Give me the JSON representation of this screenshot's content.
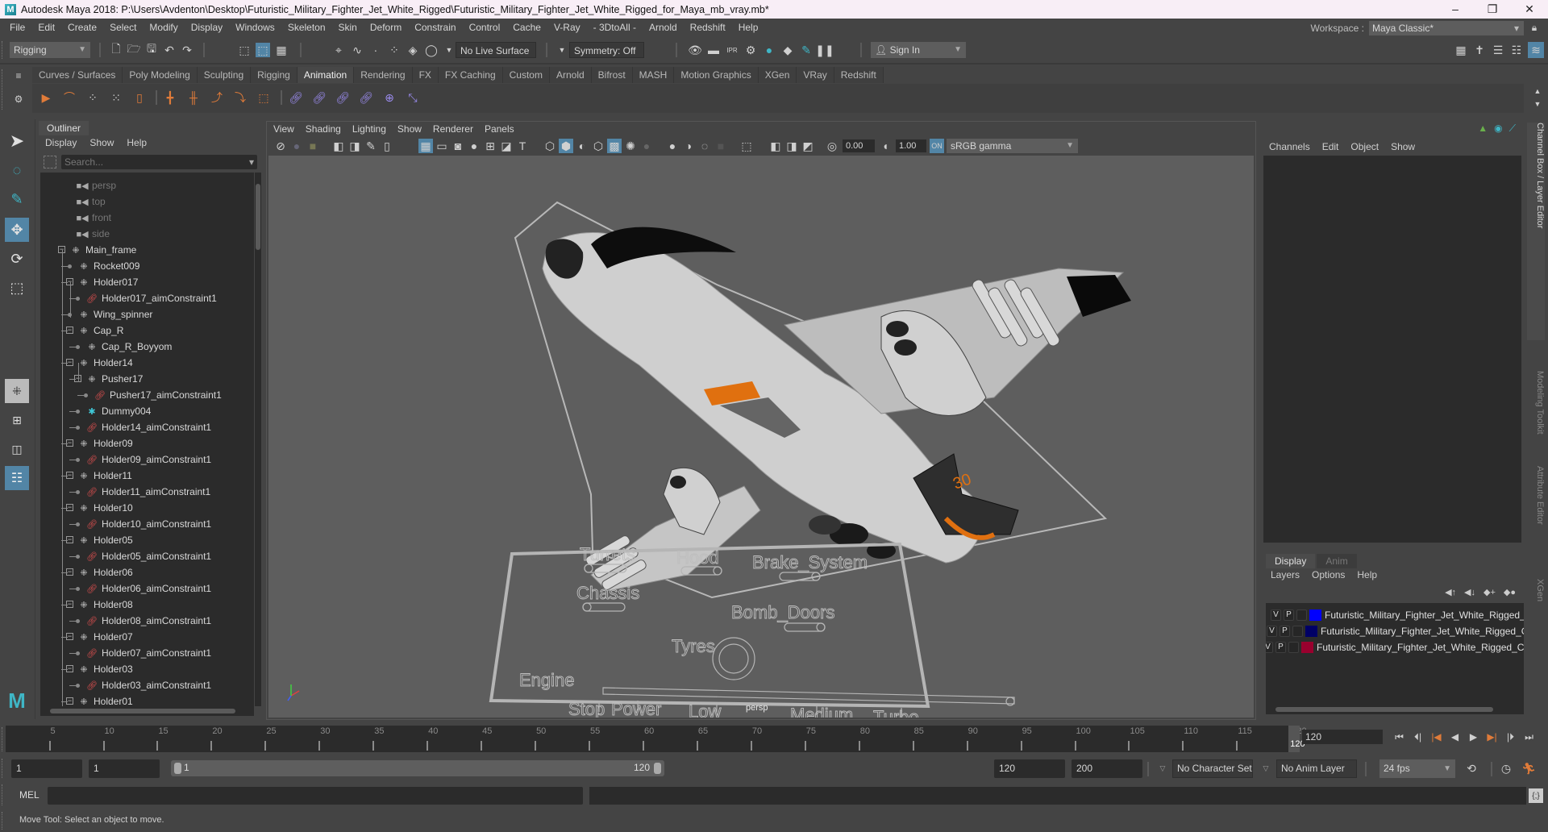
{
  "titlebar": {
    "title": "Autodesk Maya 2018: P:\\Users\\Avdenton\\Desktop\\Futuristic_Military_Fighter_Jet_White_Rigged\\Futuristic_Military_Fighter_Jet_White_Rigged_for_Maya_mb_vray.mb*",
    "minimize": "–",
    "maximize": "❐",
    "close": "✕"
  },
  "menubar": {
    "items": [
      "File",
      "Edit",
      "Create",
      "Select",
      "Modify",
      "Display",
      "Windows",
      "Skeleton",
      "Skin",
      "Deform",
      "Constrain",
      "Control",
      "Cache",
      "V-Ray",
      "- 3DtoAll -",
      "Arnold",
      "Redshift",
      "Help"
    ],
    "workspace_label": "Workspace :",
    "workspace_value": "Maya Classic*"
  },
  "statusline": {
    "menuset": "Rigging",
    "live_surface": "No Live Surface",
    "symmetry": "Symmetry: Off",
    "sign_in": "Sign In"
  },
  "shelf": {
    "tabs": [
      "Curves / Surfaces",
      "Poly Modeling",
      "Sculpting",
      "Rigging",
      "Animation",
      "Rendering",
      "FX",
      "FX Caching",
      "Custom",
      "Arnold",
      "Bifrost",
      "MASH",
      "Motion Graphics",
      "XGen",
      "VRay",
      "Redshift"
    ],
    "active_tab": "Animation"
  },
  "outliner": {
    "title": "Outliner",
    "menu": [
      "Display",
      "Show",
      "Help"
    ],
    "search_placeholder": "Search...",
    "items": [
      {
        "label": "persp",
        "type": "camera",
        "depth": 0
      },
      {
        "label": "top",
        "type": "camera",
        "depth": 0
      },
      {
        "label": "front",
        "type": "camera",
        "depth": 0
      },
      {
        "label": "side",
        "type": "camera",
        "depth": 0
      },
      {
        "label": "Main_frame",
        "type": "group",
        "depth": 0,
        "expanded": true
      },
      {
        "label": "Rocket009",
        "type": "group",
        "depth": 1
      },
      {
        "label": "Holder017",
        "type": "group",
        "depth": 1,
        "expanded": true
      },
      {
        "label": "Holder017_aimConstraint1",
        "type": "constraint",
        "depth": 2
      },
      {
        "label": "Wing_spinner",
        "type": "group",
        "depth": 1
      },
      {
        "label": "Cap_R",
        "type": "group",
        "depth": 1,
        "expanded": true
      },
      {
        "label": "Cap_R_Boyyom",
        "type": "group",
        "depth": 2
      },
      {
        "label": "Holder14",
        "type": "group",
        "depth": 1,
        "expanded": true
      },
      {
        "label": "Pusher17",
        "type": "group",
        "depth": 2,
        "expanded": true
      },
      {
        "label": "Pusher17_aimConstraint1",
        "type": "constraint",
        "depth": 3
      },
      {
        "label": "Dummy004",
        "type": "dummy",
        "depth": 2
      },
      {
        "label": "Holder14_aimConstraint1",
        "type": "constraint",
        "depth": 2
      },
      {
        "label": "Holder09",
        "type": "group",
        "depth": 1,
        "expanded": true
      },
      {
        "label": "Holder09_aimConstraint1",
        "type": "constraint",
        "depth": 2
      },
      {
        "label": "Holder11",
        "type": "group",
        "depth": 1,
        "expanded": true
      },
      {
        "label": "Holder11_aimConstraint1",
        "type": "constraint",
        "depth": 2
      },
      {
        "label": "Holder10",
        "type": "group",
        "depth": 1,
        "expanded": true
      },
      {
        "label": "Holder10_aimConstraint1",
        "type": "constraint",
        "depth": 2
      },
      {
        "label": "Holder05",
        "type": "group",
        "depth": 1,
        "expanded": true
      },
      {
        "label": "Holder05_aimConstraint1",
        "type": "constraint",
        "depth": 2
      },
      {
        "label": "Holder06",
        "type": "group",
        "depth": 1,
        "expanded": true
      },
      {
        "label": "Holder06_aimConstraint1",
        "type": "constraint",
        "depth": 2
      },
      {
        "label": "Holder08",
        "type": "group",
        "depth": 1,
        "expanded": true
      },
      {
        "label": "Holder08_aimConstraint1",
        "type": "constraint",
        "depth": 2
      },
      {
        "label": "Holder07",
        "type": "group",
        "depth": 1,
        "expanded": true
      },
      {
        "label": "Holder07_aimConstraint1",
        "type": "constraint",
        "depth": 2
      },
      {
        "label": "Holder03",
        "type": "group",
        "depth": 1,
        "expanded": true
      },
      {
        "label": "Holder03_aimConstraint1",
        "type": "constraint",
        "depth": 2
      },
      {
        "label": "Holder01",
        "type": "group",
        "depth": 1,
        "expanded": true
      }
    ]
  },
  "viewport": {
    "menu": [
      "View",
      "Shading",
      "Lighting",
      "Show",
      "Renderer",
      "Panels"
    ],
    "exposure": "0.00",
    "gamma": "1.00",
    "color_space": "sRGB gamma",
    "camera_label": "persp",
    "controls": {
      "toggles": [
        "Turrets",
        "Hood",
        "Brake_System",
        "Chassis",
        "Bomb_Doors"
      ],
      "tyres_label": "Tyres",
      "engine_label": "Engine",
      "engine_stops": [
        "Stop",
        "Power",
        "Low",
        "Medium",
        "Turbo"
      ]
    }
  },
  "channelbox": {
    "menu": [
      "Channels",
      "Edit",
      "Object",
      "Show"
    ],
    "layer_tabs": [
      "Display",
      "Anim"
    ],
    "active_layer_tab": "Display",
    "layer_menu": [
      "Layers",
      "Options",
      "Help"
    ],
    "layers": [
      {
        "v": "V",
        "p": "P",
        "color": "#0000ff",
        "name": "Futuristic_Military_Fighter_Jet_White_Rigged_Hel"
      },
      {
        "v": "V",
        "p": "P",
        "color": "#000066",
        "name": "Futuristic_Military_Fighter_Jet_White_Rigged_Geom"
      },
      {
        "v": "V",
        "p": "P",
        "color": "#99002e",
        "name": "Futuristic_Military_Fighter_Jet_White_Rigged_Contro"
      }
    ]
  },
  "side_tabs": [
    "Channel Box / Layer Editor",
    "Modeling Toolkit",
    "Attribute Editor",
    "XGen"
  ],
  "timeline": {
    "ticks": [
      "5",
      "10",
      "15",
      "20",
      "25",
      "30",
      "35",
      "40",
      "45",
      "50",
      "55",
      "60",
      "65",
      "70",
      "75",
      "80",
      "85",
      "90",
      "95",
      "100",
      "105",
      "110",
      "115",
      "120"
    ],
    "current_frame_marker": "120",
    "current_frame": "120",
    "range_start": "1",
    "anim_start": "1",
    "range_min": "1",
    "range_max": "120",
    "playback_end": "120",
    "anim_end": "200",
    "character_set": "No Character Set",
    "anim_layer": "No Anim Layer",
    "fps": "24 fps"
  },
  "commandline": {
    "mel_label": "MEL"
  },
  "helpline": {
    "text": "Move Tool: Select an object to move."
  }
}
